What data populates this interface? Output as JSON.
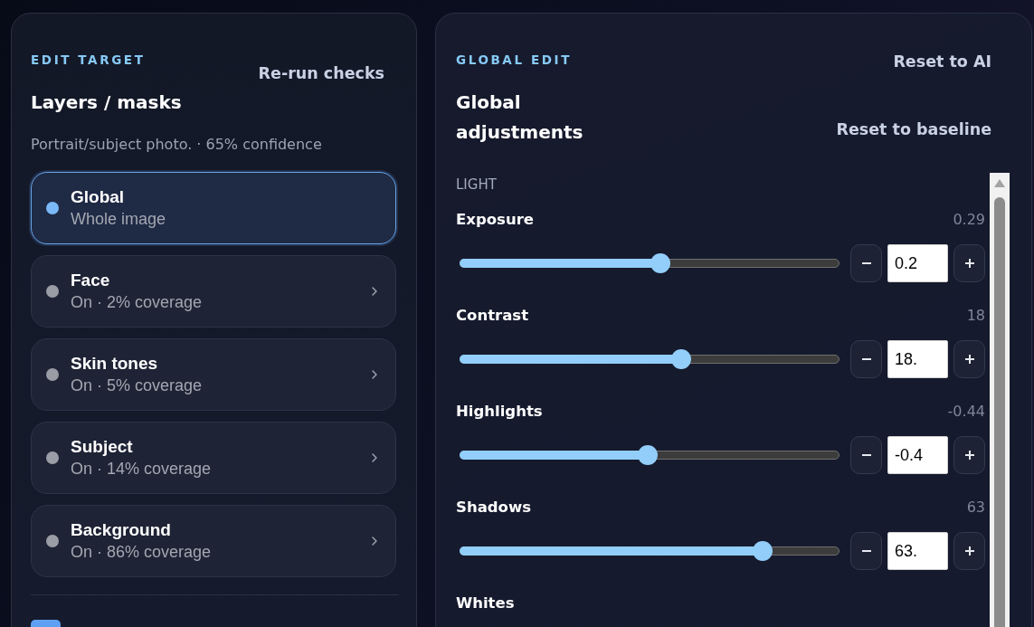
{
  "edit_target": {
    "eyebrow": "EDIT TARGET",
    "title": "Layers / masks",
    "action": "Re-run checks",
    "summary": "Portrait/subject photo. · 65% confidence",
    "layers": [
      {
        "name": "Global",
        "detail": "Whole image",
        "selected": true
      },
      {
        "name": "Face",
        "detail": "On · 2% coverage",
        "selected": false
      },
      {
        "name": "Skin tones",
        "detail": "On · 5% coverage",
        "selected": false
      },
      {
        "name": "Subject",
        "detail": "On · 14% coverage",
        "selected": false
      },
      {
        "name": "Background",
        "detail": "On · 86% coverage",
        "selected": false
      }
    ],
    "mask_edit": {
      "checked": true
    }
  },
  "global_edit": {
    "eyebrow": "GLOBAL EDIT",
    "title": "Global adjustments",
    "actions": [
      "Reset to AI",
      "Reset to baseline"
    ],
    "sections": [
      {
        "label": "LIGHT",
        "sliders": [
          {
            "label": "Exposure",
            "reading": "0.29",
            "level": 0.529,
            "value": "0.2"
          },
          {
            "label": "Contrast",
            "reading": "18",
            "level": 0.589,
            "value": "18."
          },
          {
            "label": "Highlights",
            "reading": "-0.44",
            "level": 0.496,
            "value": "-0.4"
          },
          {
            "label": "Shadows",
            "reading": "63",
            "level": 0.815,
            "value": "63."
          },
          {
            "label": "Whites"
          }
        ]
      }
    ]
  }
}
